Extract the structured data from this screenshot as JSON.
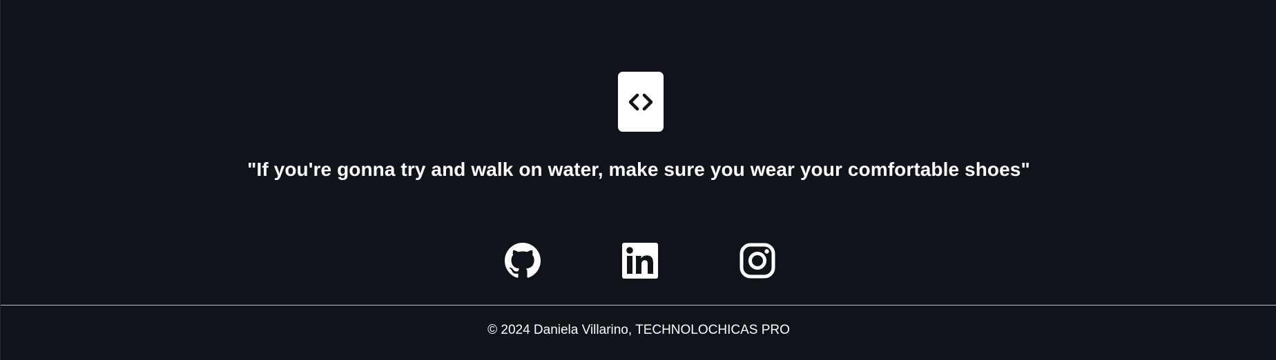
{
  "logo": {
    "icon": "code-brackets-icon"
  },
  "quote": {
    "text": "\"If you're gonna try and walk on water, make sure you wear your comfortable shoes\""
  },
  "social": [
    {
      "name": "GitHub",
      "icon": "github-icon"
    },
    {
      "name": "LinkedIn",
      "icon": "linkedin-icon"
    },
    {
      "name": "Instagram",
      "icon": "instagram-icon"
    }
  ],
  "footer": {
    "copyright": "© 2024 Daniela Villarino, TECHNOLOCHICAS PRO"
  },
  "colors": {
    "background": "#11131b",
    "foreground": "#ffffff",
    "divider": "#b9bcc4"
  }
}
